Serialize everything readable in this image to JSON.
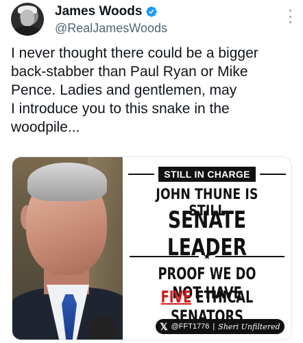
{
  "tweet": {
    "author_name": "James Woods",
    "author_handle": "@RealJamesWoods",
    "text": "I never thought there could be a bigger\nback-stabber than Paul Ryan or Mike\nPence. Ladies and gentlemen, may\nI introduce you to this snake in the\nwoodpile...",
    "verified_color": "#1d9bf0"
  },
  "meme": {
    "badge": "STILL IN CHARGE",
    "line1": "JOHN THUNE IS STILL",
    "line2": "SENATE LEADER",
    "star": "★",
    "line3": "PROOF WE DO NOT HAVE",
    "line4_highlight": "FIVE",
    "line4_rest": " ETHICAL SENATORS",
    "footer_x": "𝕏",
    "footer_handle": "@FFT1776",
    "footer_sep": "|",
    "footer_signature": "Sheri Unfiltered",
    "highlight_color": "#d21a1a"
  }
}
